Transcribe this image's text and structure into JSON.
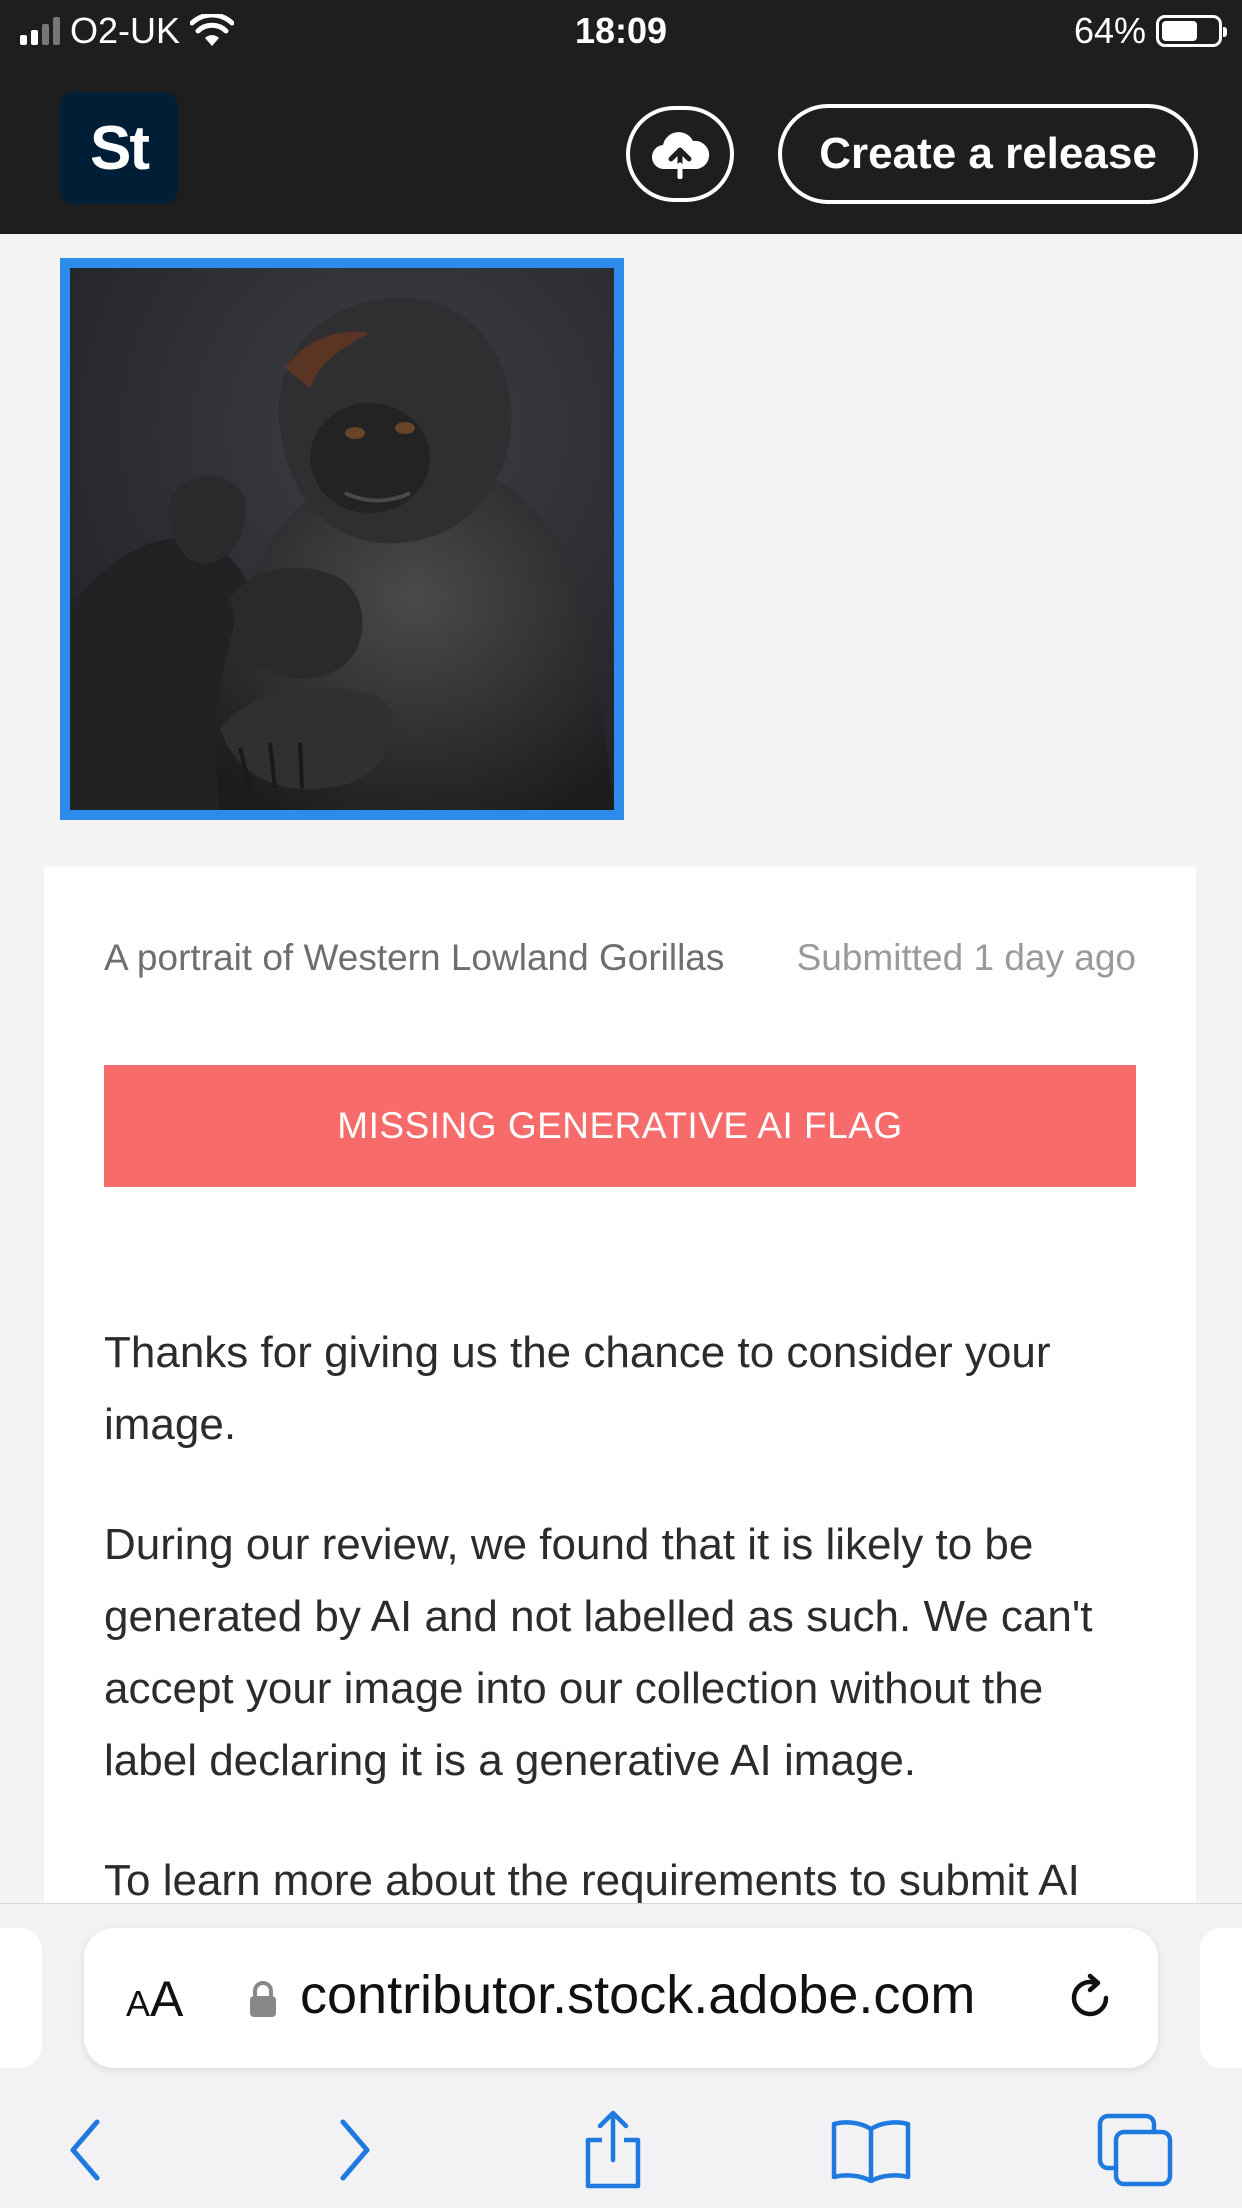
{
  "status_bar": {
    "carrier": "O2-UK",
    "time": "18:09",
    "battery_percent": "64%",
    "battery_level": 0.64
  },
  "header": {
    "logo_text": "St",
    "upload_icon": "cloud-upload-icon",
    "create_release_label": "Create a release"
  },
  "submission": {
    "thumbnail_icon": "gorilla-portrait-image",
    "thumbnail_border_color": "#2d8ceb",
    "title": "A portrait of Western Lowland Gorillas",
    "submitted": "Submitted 1 day ago",
    "flag_label": "MISSING GENERATIVE AI FLAG",
    "flag_color": "#f76b6b",
    "paragraphs": [
      "Thanks for giving us the chance to consider your image.",
      "During our review, we found that it is likely to be generated by AI and not labelled as such. We can't accept your image into our collection without the label declaring it is a generative AI image.",
      "To learn more about the requirements to submit AI"
    ]
  },
  "browser": {
    "reader_label_small": "A",
    "reader_label_large": "A",
    "url": "contributor.stock.adobe.com",
    "lock_icon": "lock-icon",
    "reload_icon": "reload-icon",
    "toolbar_icons": [
      "back-icon",
      "forward-icon",
      "share-icon",
      "bookmarks-icon",
      "tabs-icon"
    ],
    "accent_color": "#1f7ae0"
  }
}
